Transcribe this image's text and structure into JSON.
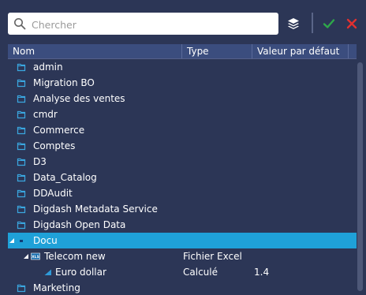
{
  "search": {
    "placeholder": "Chercher",
    "value": ""
  },
  "toolbar": {
    "layers_icon": "layers-icon",
    "confirm_icon": "check-icon",
    "cancel_icon": "close-icon",
    "confirm_color": "#2ea84a",
    "cancel_color": "#e03030"
  },
  "columns": [
    "Nom",
    "Type",
    "Valeur par défaut",
    ""
  ],
  "colors": {
    "background": "#2c3656",
    "header": "#3b4d7e",
    "selected": "#1fa1d8",
    "folder": "#3aa7e0"
  },
  "rows": [
    {
      "label": "admin",
      "type": "",
      "value": "",
      "level": 0,
      "kind": "folder",
      "expanded": false,
      "selected": false
    },
    {
      "label": "Migration BO",
      "type": "",
      "value": "",
      "level": 0,
      "kind": "folder",
      "expanded": false,
      "selected": false
    },
    {
      "label": "Analyse des ventes",
      "type": "",
      "value": "",
      "level": 0,
      "kind": "folder",
      "expanded": false,
      "selected": false
    },
    {
      "label": "cmdr",
      "type": "",
      "value": "",
      "level": 0,
      "kind": "folder",
      "expanded": false,
      "selected": false
    },
    {
      "label": "Commerce",
      "type": "",
      "value": "",
      "level": 0,
      "kind": "folder",
      "expanded": false,
      "selected": false
    },
    {
      "label": "Comptes",
      "type": "",
      "value": "",
      "level": 0,
      "kind": "folder",
      "expanded": false,
      "selected": false
    },
    {
      "label": "D3",
      "type": "",
      "value": "",
      "level": 0,
      "kind": "folder",
      "expanded": false,
      "selected": false
    },
    {
      "label": "Data_Catalog",
      "type": "",
      "value": "",
      "level": 0,
      "kind": "folder",
      "expanded": false,
      "selected": false
    },
    {
      "label": "DDAudit",
      "type": "",
      "value": "",
      "level": 0,
      "kind": "folder",
      "expanded": false,
      "selected": false
    },
    {
      "label": "Digdash Metadata Service",
      "type": "",
      "value": "",
      "level": 0,
      "kind": "folder",
      "expanded": false,
      "selected": false
    },
    {
      "label": "Digdash Open Data",
      "type": "",
      "value": "",
      "level": 0,
      "kind": "folder",
      "expanded": false,
      "selected": false
    },
    {
      "label": "Docu",
      "type": "",
      "value": "",
      "level": 0,
      "kind": "folder-open",
      "expanded": true,
      "selected": true
    },
    {
      "label": "Telecom new",
      "type": "Fichier Excel",
      "value": "",
      "level": 1,
      "kind": "excel",
      "expanded": true,
      "selected": false
    },
    {
      "label": "Euro dollar",
      "type": "Calculé",
      "value": "1.4",
      "level": 2,
      "kind": "measure",
      "expanded": false,
      "selected": false
    },
    {
      "label": "Marketing",
      "type": "",
      "value": "",
      "level": 0,
      "kind": "folder",
      "expanded": false,
      "selected": false
    }
  ]
}
